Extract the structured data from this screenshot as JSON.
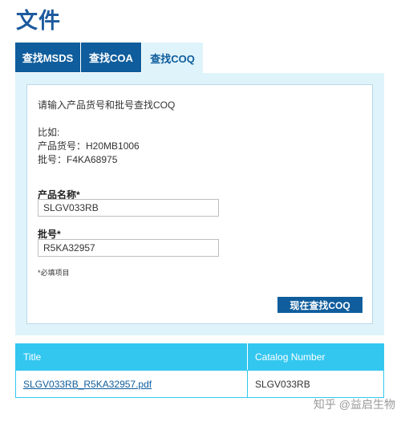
{
  "page": {
    "title": "文件"
  },
  "tabs": [
    {
      "label": "查找MSDS",
      "active": false
    },
    {
      "label": "查找COA",
      "active": false
    },
    {
      "label": "查找COQ",
      "active": true
    }
  ],
  "form": {
    "instruction": "请输入产品货号和批号查找COQ",
    "example_heading": "比如:",
    "example_product": "产品货号：H20MB1006",
    "example_lot": "批号：F4KA68975",
    "product_label": "产品名称*",
    "product_value": "SLGV033RB",
    "lot_label": "批号*",
    "lot_value": "R5KA32957",
    "required_note": "*必填项目",
    "submit_label": "现在查找COQ"
  },
  "results": {
    "columns": [
      "Title",
      "Catalog Number"
    ],
    "rows": [
      {
        "title": "SLGV033RB_R5KA32957.pdf",
        "catalog": "SLGV033RB"
      }
    ]
  },
  "watermark": "知乎 @益启生物",
  "colors": {
    "brand_blue": "#0f5d9c",
    "header_cyan": "#33c7f0",
    "panel_bg": "#dff3fb"
  }
}
